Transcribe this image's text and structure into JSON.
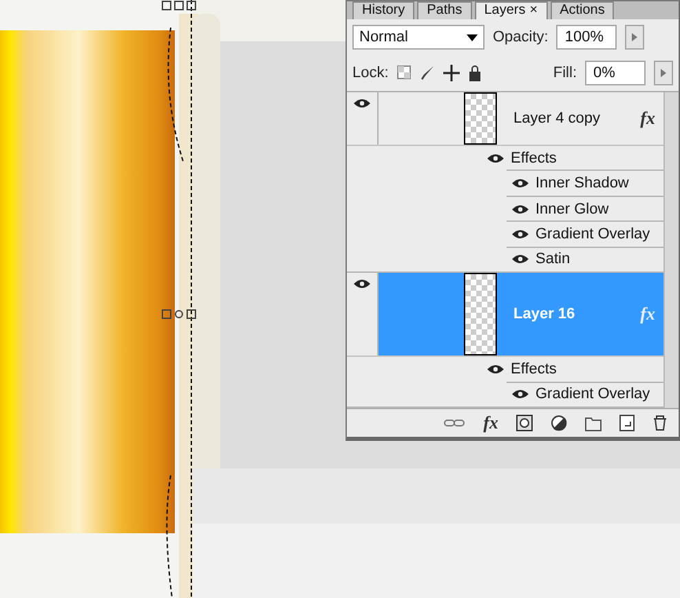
{
  "tabs": [
    {
      "label": "History",
      "selected": false
    },
    {
      "label": "Paths",
      "selected": false
    },
    {
      "label": "Layers",
      "selected": true,
      "close": "×"
    },
    {
      "label": "Actions",
      "selected": false
    }
  ],
  "blend_mode": "Normal",
  "opacity": {
    "label": "Opacity:",
    "value": "100%"
  },
  "lock": {
    "label": "Lock:"
  },
  "fill": {
    "label": "Fill:",
    "value": "0%"
  },
  "layers": [
    {
      "name": "Layer 4 copy",
      "selected": false,
      "visible": true,
      "fx": "fx",
      "effects_label": "Effects",
      "effects": [
        {
          "name": "Inner Shadow",
          "visible": true
        },
        {
          "name": "Inner Glow",
          "visible": true
        },
        {
          "name": "Gradient Overlay",
          "visible": true
        },
        {
          "name": "Satin",
          "visible": true
        }
      ]
    },
    {
      "name": "Layer 16",
      "selected": true,
      "visible": true,
      "fx": "fx",
      "effects_label": "Effects",
      "effects": [
        {
          "name": "Gradient Overlay",
          "visible": true
        }
      ]
    }
  ],
  "toolbar_fx": "fx"
}
